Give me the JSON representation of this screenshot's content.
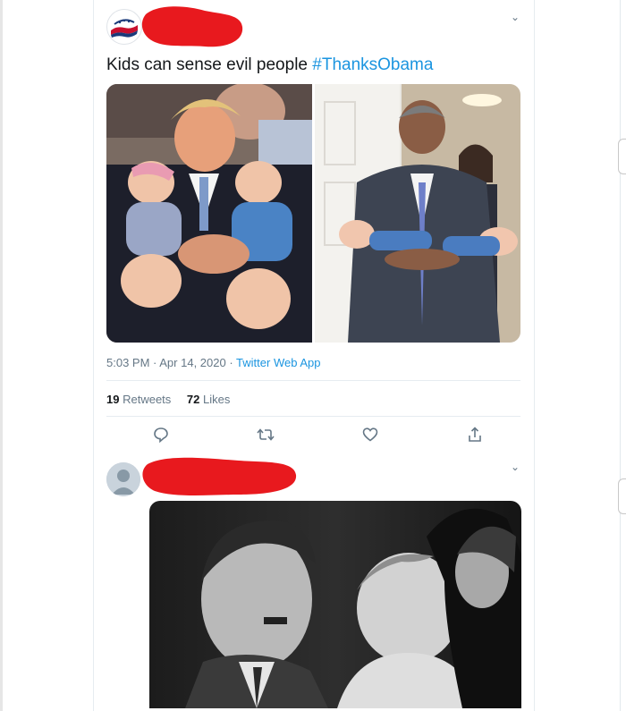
{
  "tweet1": {
    "text": "Kids can sense evil people ",
    "hashtag": "#ThanksObama",
    "time": "5:03 PM",
    "date": "Apr 14, 2020",
    "separator": " · ",
    "source": "Twitter Web App",
    "retweets_count": "19",
    "retweets_label": "Retweets",
    "likes_count": "72",
    "likes_label": "Likes",
    "avatar_logo_text": "GOP",
    "images": [
      "photo-two-crying-babies",
      "photo-two-sleeping-babies"
    ],
    "actions": [
      "reply-icon",
      "retweet-icon",
      "like-icon",
      "share-icon"
    ]
  },
  "tweet2": {
    "image": "photo-black-and-white-man-with-baby"
  },
  "colors": {
    "link": "#1b95e0",
    "secondary_text": "#657786",
    "redaction": "#e8191e",
    "divider": "#e6ecf0"
  }
}
